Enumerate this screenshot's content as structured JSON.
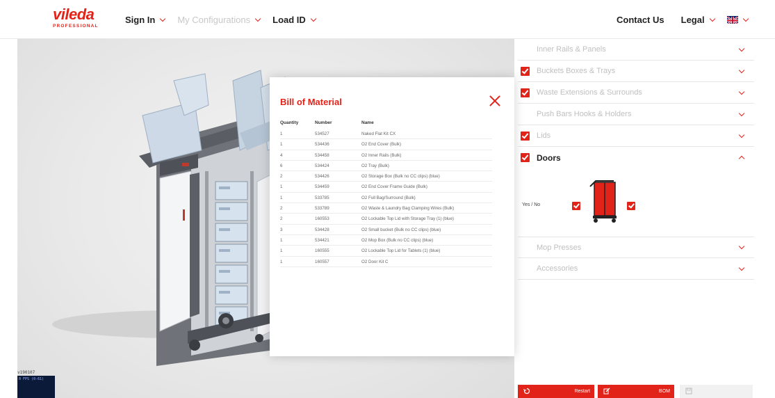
{
  "header": {
    "logo_text": "vileda",
    "logo_subtext": "PROFESSIONAL",
    "sign_in": "Sign In",
    "my_configurations": "My Configurations",
    "load_id": "Load ID",
    "contact_us": "Contact Us",
    "legal": "Legal",
    "language_icon": "uk-flag-icon"
  },
  "viewport": {
    "version_label": "v190107",
    "fps_label": "0 FPS (0-61)"
  },
  "panel": {
    "categories": [
      {
        "label": "Inner Rails & Panels",
        "checked": false,
        "active": false
      },
      {
        "label": "Buckets Boxes & Trays",
        "checked": true,
        "active": false
      },
      {
        "label": "Waste Extensions & Surrounds",
        "checked": true,
        "active": false
      },
      {
        "label": "Push Bars Hooks & Holders",
        "checked": false,
        "active": false
      },
      {
        "label": "Lids",
        "checked": true,
        "active": false
      },
      {
        "label": "Doors",
        "checked": true,
        "active": true
      }
    ],
    "doors_option_label": "Yes / No",
    "categories_after": [
      {
        "label": "Mop Presses",
        "checked": false
      },
      {
        "label": "Accessories",
        "checked": false
      }
    ],
    "restart_label": "Restart",
    "bom_label": "BOM"
  },
  "modal": {
    "title": "Bill of Material",
    "columns": {
      "quantity": "Quantity",
      "number": "Number",
      "name": "Name"
    },
    "rows": [
      {
        "quantity": "1",
        "number": "534527",
        "name": "Naked Flat Kit CX"
      },
      {
        "quantity": "1",
        "number": "534436",
        "name": "O2 End Cover (Bulk)"
      },
      {
        "quantity": "4",
        "number": "534458",
        "name": "O2 Inner Rails (Bulk)"
      },
      {
        "quantity": "6",
        "number": "534424",
        "name": "O2 Tray (Bulk)"
      },
      {
        "quantity": "2",
        "number": "534426",
        "name": "O2 Storage Box (Bulk no CC clips) (blue)"
      },
      {
        "quantity": "1",
        "number": "534459",
        "name": "O2 End Cover Frame Guide (Bulk)"
      },
      {
        "quantity": "1",
        "number": "533785",
        "name": "O2 Full Bag/Surround (Bulk)"
      },
      {
        "quantity": "2",
        "number": "533789",
        "name": "O2 Waste & Laundry Bag Clamping Wires (Bulk)"
      },
      {
        "quantity": "2",
        "number": "160553",
        "name": "O2 Lockable Top Lid with Storage Tray (1) (blue)"
      },
      {
        "quantity": "3",
        "number": "534428",
        "name": "O2 Small bucket (Bulk no CC clips) (blue)"
      },
      {
        "quantity": "1",
        "number": "534421",
        "name": "O2 Mop Box (Bulk no CC clips) (blue)"
      },
      {
        "quantity": "1",
        "number": "160555",
        "name": "O2 Lockable Top Lid for Tablets (1) (blue)"
      },
      {
        "quantity": "1",
        "number": "160557",
        "name": "O2 Door Kit C"
      }
    ]
  },
  "colors": {
    "brand_red": "#e2231a",
    "muted_text": "#c0c0c0",
    "viewport_bg": "#e9e9e9"
  }
}
